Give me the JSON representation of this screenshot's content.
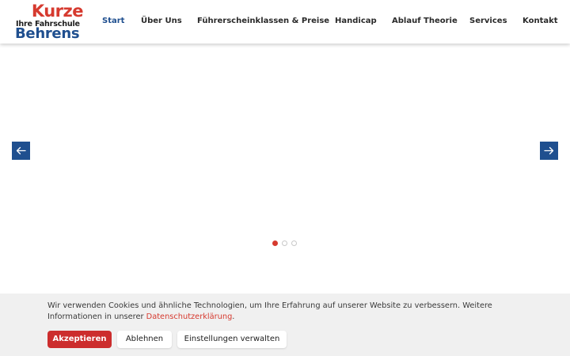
{
  "brand": {
    "line1": "Kurze",
    "line2": "Ihre Fahrschule",
    "line3": "Behrens",
    "colors": {
      "red": "#d63a2f",
      "blue": "#1f4f8f",
      "dark": "#1c1c1c"
    }
  },
  "nav": {
    "items": [
      {
        "label": "Start",
        "active": true
      },
      {
        "label": "Über Uns"
      },
      {
        "label": "Führerscheinklassen & Preise"
      },
      {
        "label": "Handicap"
      },
      {
        "label": "Ablauf Theorie"
      },
      {
        "label": "Services"
      },
      {
        "label": "Kontakt"
      }
    ]
  },
  "slider": {
    "prev_icon": "arrow-left-icon",
    "next_icon": "arrow-right-icon",
    "slide_count": 3,
    "active_slide": 1
  },
  "cookie": {
    "text": "Wir verwenden Cookies und ähnliche Technologien, um Ihre Erfahrung auf unserer Website zu verbessern. Weitere Informationen in unserer",
    "link_label": "Datenschutzerklärung",
    "trailing": ".",
    "accept_label": "Akzeptieren",
    "decline_label": "Ablehnen",
    "settings_label": "Einstellungen verwalten"
  }
}
